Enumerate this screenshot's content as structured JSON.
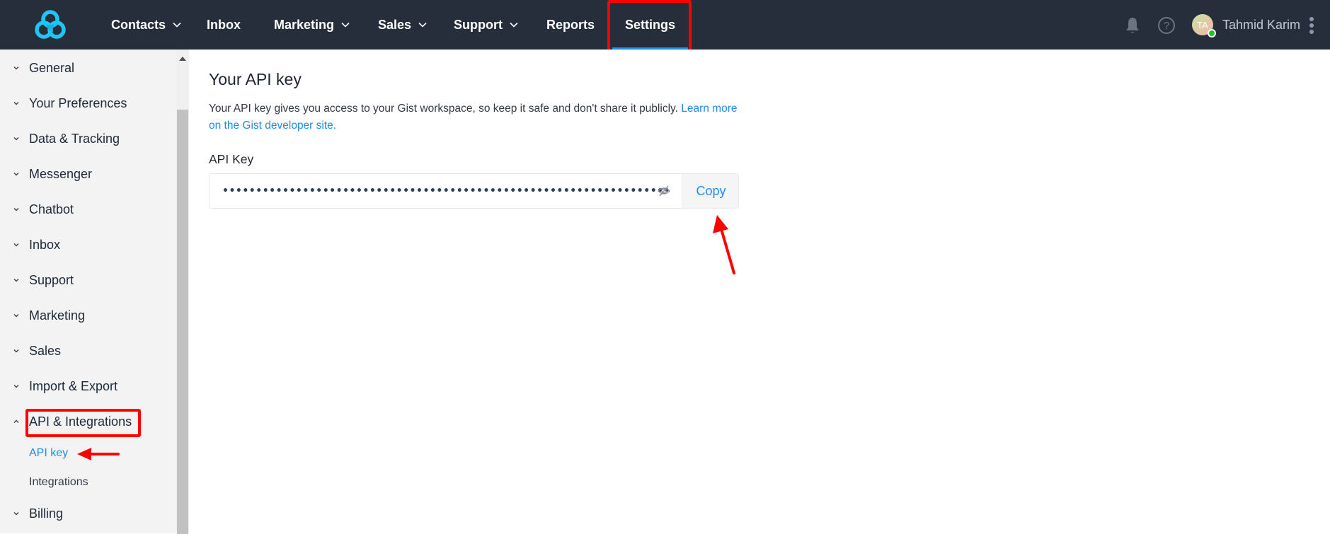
{
  "topnav": {
    "logo": "gist-logo-icon",
    "items": [
      {
        "label": "Contacts",
        "has_dropdown": true
      },
      {
        "label": "Inbox",
        "has_dropdown": false
      },
      {
        "label": "Marketing",
        "has_dropdown": true
      },
      {
        "label": "Sales",
        "has_dropdown": true
      },
      {
        "label": "Support",
        "has_dropdown": true
      },
      {
        "label": "Reports",
        "has_dropdown": false
      },
      {
        "label": "Settings",
        "has_dropdown": false,
        "active": true
      }
    ],
    "help_glyph": "?",
    "user": {
      "initials": "TA",
      "name": "Tahmid Karim",
      "status": "online"
    }
  },
  "sidebar": {
    "items": [
      {
        "label": "General",
        "expanded": false
      },
      {
        "label": "Your Preferences",
        "expanded": false
      },
      {
        "label": "Data & Tracking",
        "expanded": false
      },
      {
        "label": "Messenger",
        "expanded": false
      },
      {
        "label": "Chatbot",
        "expanded": false
      },
      {
        "label": "Inbox",
        "expanded": false
      },
      {
        "label": "Support",
        "expanded": false
      },
      {
        "label": "Marketing",
        "expanded": false
      },
      {
        "label": "Sales",
        "expanded": false
      },
      {
        "label": "Import & Export",
        "expanded": false
      },
      {
        "label": "API & Integrations",
        "expanded": true
      },
      {
        "label": "Billing",
        "expanded": false
      }
    ],
    "sub_items": [
      {
        "label": "API key",
        "active": true
      },
      {
        "label": "Integrations",
        "active": false
      }
    ]
  },
  "main": {
    "title": "Your API key",
    "description": "Your API key gives you access to your Gist workspace, so keep it safe and don't share it publicly. ",
    "link_text": "Learn more on the Gist developer site.",
    "field_label": "API Key",
    "api_key_masked": "•••••••••••••••••••••••••••••••••••••••••••••••••••••••••••••••••••",
    "copy_label": "Copy"
  },
  "colors": {
    "nav_bg": "#252e3a",
    "accent": "#1e8cf0",
    "sidebar_bg": "#f3f3f3",
    "annotation": "#ff0000",
    "online": "#22c42a"
  }
}
